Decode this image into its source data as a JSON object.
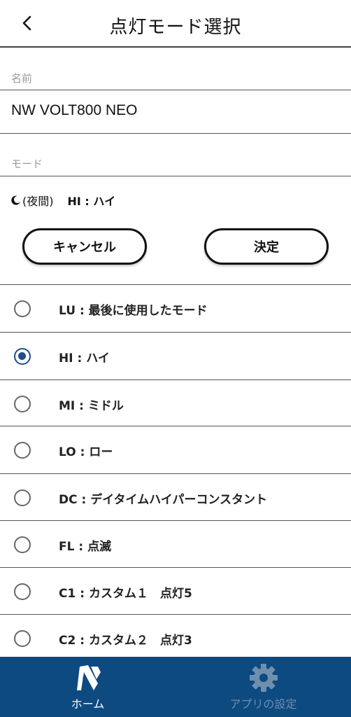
{
  "header": {
    "title": "点灯モード選択"
  },
  "name_section": {
    "label": "名前",
    "value": "NW VOLT800 NEO"
  },
  "mode_section": {
    "label": "モード"
  },
  "current": {
    "night_label": "(夜間)",
    "mode_label": "HI : ハイ"
  },
  "buttons": {
    "cancel": "キャンセル",
    "ok": "決定"
  },
  "modes": [
    {
      "label": "LU : 最後に使用したモード",
      "selected": false
    },
    {
      "label": "HI : ハイ",
      "selected": true
    },
    {
      "label": "MI : ミドル",
      "selected": false
    },
    {
      "label": "LO : ロー",
      "selected": false
    },
    {
      "label": "DC : デイタイムハイパーコンスタント",
      "selected": false
    },
    {
      "label": "FL : 点滅",
      "selected": false
    },
    {
      "label": "C1 : カスタム１　点灯5",
      "selected": false
    },
    {
      "label": "C2 : カスタム２　点灯3",
      "selected": false
    }
  ],
  "tabbar": {
    "home_label": "ホーム",
    "settings_label": "アプリの設定",
    "home_icon": "brand-logo-icon",
    "settings_icon": "gear-icon",
    "colors": {
      "background": "#0d4a80",
      "active": "#ffffff",
      "inactive": "#6f8fae"
    }
  },
  "colors": {
    "radio_selected": "#1b4f86"
  }
}
